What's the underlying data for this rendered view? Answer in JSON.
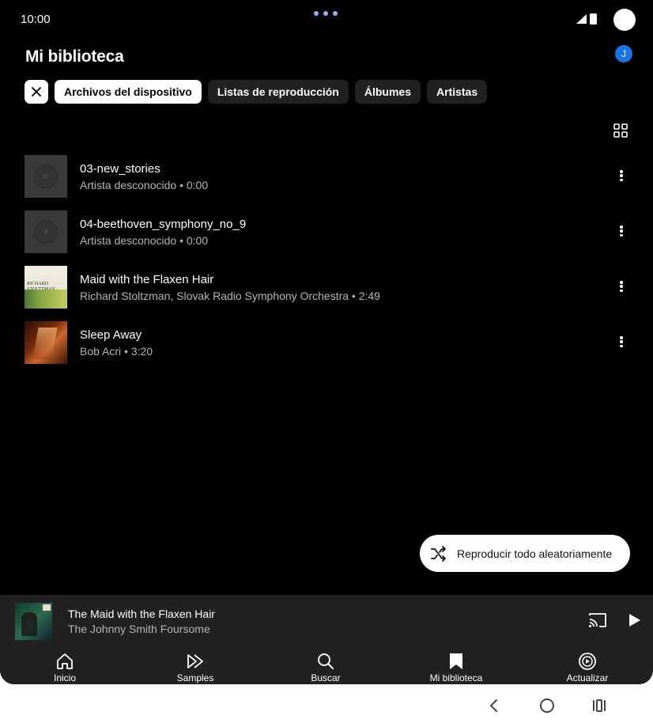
{
  "status_bar": {
    "time": "10:00"
  },
  "header": {
    "title": "Mi biblioteca",
    "avatar_initial": "J"
  },
  "filter_chips": [
    {
      "label": "Archivos del dispositivo",
      "selected": true
    },
    {
      "label": "Listas de reproducción",
      "selected": false
    },
    {
      "label": "Álbumes",
      "selected": false
    },
    {
      "label": "Artistas",
      "selected": false
    }
  ],
  "tracks": [
    {
      "title": "03-new_stories",
      "subtitle": "Artista desconocido • 0:00",
      "art": "placeholder-disc-icon"
    },
    {
      "title": "04-beethoven_symphony_no_9",
      "subtitle": "Artista desconocido • 0:00",
      "art": "placeholder-disc-icon"
    },
    {
      "title": "Maid with the Flaxen Hair",
      "subtitle": "Richard Stoltzman, Slovak Radio Symphony Orchestra • 2:49",
      "art": "album-cover",
      "cover_text": "RICHARD STOLTZMAN"
    },
    {
      "title": "Sleep Away",
      "subtitle": "Bob Acri • 3:20",
      "art": "album-cover"
    }
  ],
  "shuffle_button": {
    "label": "Reproducir todo aleatoriamente",
    "icon": "shuffle-icon"
  },
  "mini_player": {
    "title": "The Maid with the Flaxen Hair",
    "artist": "The Johnny Smith Foursome",
    "icons": [
      "cast-icon",
      "play-icon"
    ]
  },
  "bottom_nav": [
    {
      "label": "Inicio",
      "icon": "home-icon"
    },
    {
      "label": "Samples",
      "icon": "samples-icon"
    },
    {
      "label": "Buscar",
      "icon": "search-icon"
    },
    {
      "label": "Mi biblioteca",
      "icon": "library-icon",
      "active": true
    },
    {
      "label": "Actualizar",
      "icon": "upgrade-icon"
    }
  ],
  "colors": {
    "background": "#000000",
    "surface": "#212121",
    "chip_selected": "#ffffff",
    "secondary_text": "#b3b3b3",
    "avatar": "#1a73e8",
    "status_dots": "#8ab4f8"
  }
}
